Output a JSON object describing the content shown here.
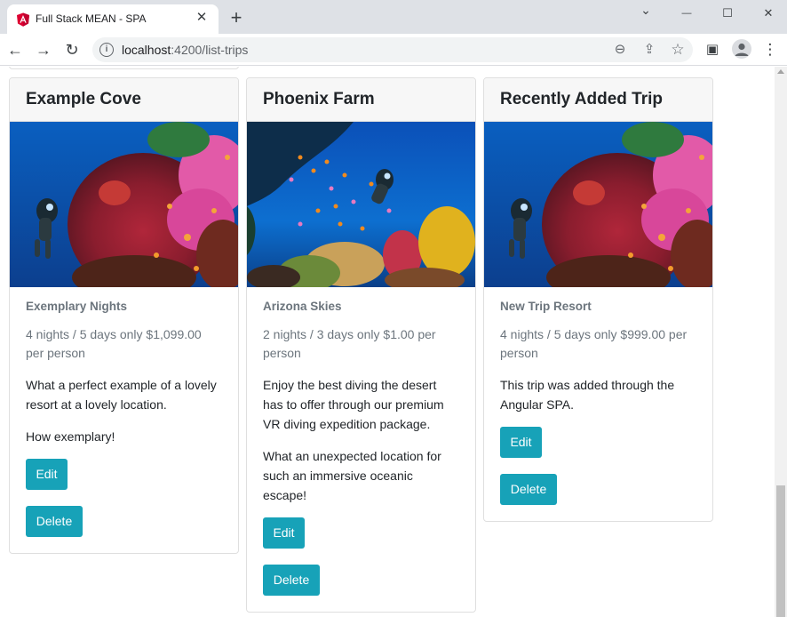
{
  "browser": {
    "tab_title": "Full Stack MEAN - SPA",
    "url_host": "localhost",
    "url_path": ":4200/list-trips"
  },
  "icons": {
    "tab_close": "✕",
    "new_tab": "+",
    "minimize": "—",
    "maximize": "☐",
    "window_close": "✕",
    "chevron": "⌄",
    "back": "←",
    "forward": "→",
    "reload": "↻",
    "info": "i",
    "zoom": "⊖",
    "share": "⇪",
    "star": "☆",
    "sidepanel": "▣",
    "menu": "⋮"
  },
  "colors": {
    "accent": "#17a2b8",
    "muted": "#6c757d",
    "header_bg": "#f7f7f7"
  },
  "trips": [
    {
      "title": "Example Cove",
      "resort": "Exemplary Nights",
      "length_price": "4 nights / 5 days only $1,099.00 per person",
      "description": [
        "What a perfect example of a lovely resort at a lovely location.",
        "How exemplary!"
      ],
      "edit_label": "Edit",
      "delete_label": "Delete",
      "image": "reef-diver-coral"
    },
    {
      "title": "Phoenix Farm",
      "resort": "Arizona Skies",
      "length_price": "2 nights / 3 days only $1.00 per person",
      "description": [
        "Enjoy the best diving the desert has to offer through our premium VR diving expedition package.",
        "What an unexpected location for such an immersive oceanic escape!"
      ],
      "edit_label": "Edit",
      "delete_label": "Delete",
      "image": "reef-diver-fish"
    },
    {
      "title": "Recently Added Trip",
      "resort": "New Trip Resort",
      "length_price": "4 nights / 5 days only $999.00 per person",
      "description": [
        "This trip was added through the Angular SPA."
      ],
      "edit_label": "Edit",
      "delete_label": "Delete",
      "image": "reef-diver-coral"
    }
  ]
}
